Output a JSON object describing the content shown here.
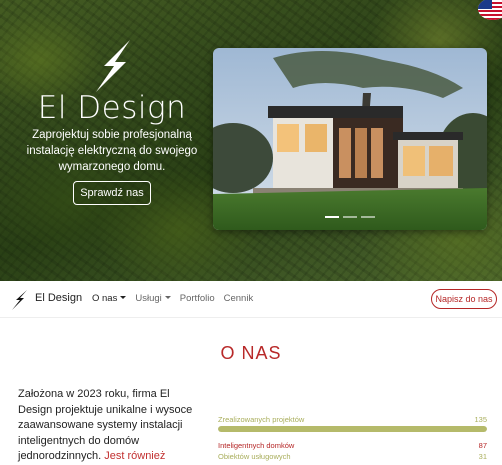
{
  "hero": {
    "title": "El Design",
    "subtitle": "Zaprojektuj sobie profesjonalną instalację elektryczną do swojego wymarzonego domu.",
    "button_label": "Sprawdź nas"
  },
  "carousel": {
    "slides": 3,
    "active_index": 0
  },
  "navbar": {
    "brand": "El Design",
    "links": [
      {
        "label": "O nas",
        "dropdown": true,
        "active": true
      },
      {
        "label": "Usługi",
        "dropdown": true,
        "active": false
      },
      {
        "label": "Portfolio",
        "dropdown": false,
        "active": false
      },
      {
        "label": "Cennik",
        "dropdown": false,
        "active": false
      }
    ],
    "cta_label": "Napisz do nas"
  },
  "about": {
    "title": "O NAS",
    "text": "Założona w 2023 roku, firma El Design projektuje unikalne i wysoce zaawansowane systemy instalacji inteligentnych do domów jednorodzinnych.",
    "link_text": "Jest również"
  },
  "stats": [
    {
      "label": "Zrealizowanych projektów",
      "value": "135",
      "fill": 1.0,
      "color": "#b5ba6a"
    },
    {
      "label": "Inteligentnych domków",
      "value": "87",
      "fill": 0.64,
      "color": "#b52626"
    },
    {
      "label": "Obiektów usługowych",
      "value": "31",
      "fill": 0.23,
      "color": "#b5ba6a"
    }
  ],
  "colors": {
    "accent": "#b82929",
    "olive": "#b5ba6a"
  },
  "icons": {
    "logo": "lightning-bolt-icon",
    "language": "us-flag-icon"
  }
}
